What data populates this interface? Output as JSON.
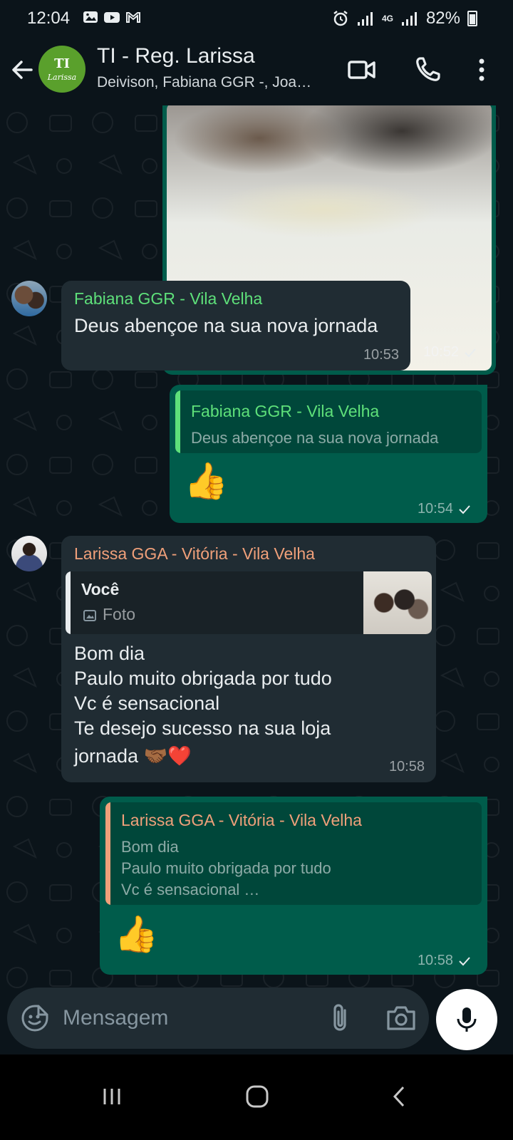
{
  "status_bar": {
    "time": "12:04",
    "battery": "82%",
    "network": "4G"
  },
  "header": {
    "group_name": "TI - Reg. Larissa",
    "members": "Deivison, Fabiana GGR -, Joa…",
    "avatar_top": "TI",
    "avatar_bottom": "Larissa"
  },
  "messages": [
    {
      "type": "image",
      "direction": "outgoing",
      "time": "10:52"
    },
    {
      "type": "text",
      "direction": "incoming",
      "sender": "Fabiana GGR - Vila Velha",
      "sender_color": "#5ee07a",
      "text": "Deus abençoe na sua nova jornada",
      "time": "10:53"
    },
    {
      "type": "reply",
      "direction": "outgoing",
      "quoted_sender": "Fabiana GGR - Vila Velha",
      "quoted_color": "#5ee07a",
      "quoted_text": "Deus abençoe na sua nova jornada",
      "text": "👍",
      "time": "10:54"
    },
    {
      "type": "reply",
      "direction": "incoming",
      "sender": "Larissa GGA - Vitória - Vila Velha",
      "sender_color": "#f0a07a",
      "quoted_sender": "Você",
      "quoted_text": "Foto",
      "lines": [
        "Bom dia",
        "Paulo muito obrigada por tudo",
        "Vc é sensacional",
        "Te desejo sucesso na sua loja",
        "jornada 🤝🏾❤️"
      ],
      "time": "10:58"
    },
    {
      "type": "reply",
      "direction": "outgoing",
      "quoted_sender": "Larissa GGA - Vitória - Vila Velha",
      "quoted_color": "#f0a07a",
      "quoted_lines": [
        "Bom dia",
        "Paulo muito obrigada por tudo",
        "Vc é sensacional …"
      ],
      "text": "👍",
      "time": "10:58"
    }
  ],
  "composer": {
    "placeholder": "Mensagem"
  },
  "colors": {
    "background": "#0b141a",
    "incoming_bubble": "#202c33",
    "outgoing_bubble": "#005c4b",
    "accent": "#00a884"
  }
}
